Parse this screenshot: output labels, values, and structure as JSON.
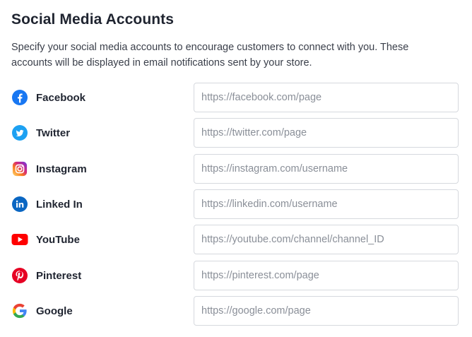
{
  "section": {
    "title": "Social Media Accounts",
    "description": "Specify your social media accounts to encourage customers to connect with you. These accounts will be displayed in email notifications sent by your store."
  },
  "accounts": [
    {
      "label": "Facebook",
      "icon": "facebook-icon",
      "value": "",
      "placeholder": "https://facebook.com/page",
      "color": "#1877F2"
    },
    {
      "label": "Twitter",
      "icon": "twitter-icon",
      "value": "",
      "placeholder": "https://twitter.com/page",
      "color": "#1DA1F2"
    },
    {
      "label": "Instagram",
      "icon": "instagram-icon",
      "value": "",
      "placeholder": "https://instagram.com/username",
      "color": "#D6249F"
    },
    {
      "label": "Linked In",
      "icon": "linkedin-icon",
      "value": "",
      "placeholder": "https://linkedin.com/username",
      "color": "#0A66C2"
    },
    {
      "label": "YouTube",
      "icon": "youtube-icon",
      "value": "",
      "placeholder": "https://youtube.com/channel/channel_ID",
      "color": "#FF0000"
    },
    {
      "label": "Pinterest",
      "icon": "pinterest-icon",
      "value": "",
      "placeholder": "https://pinterest.com/page",
      "color": "#E60023"
    },
    {
      "label": "Google",
      "icon": "google-icon",
      "value": "",
      "placeholder": "https://google.com/page",
      "color": "#4285F4"
    }
  ]
}
